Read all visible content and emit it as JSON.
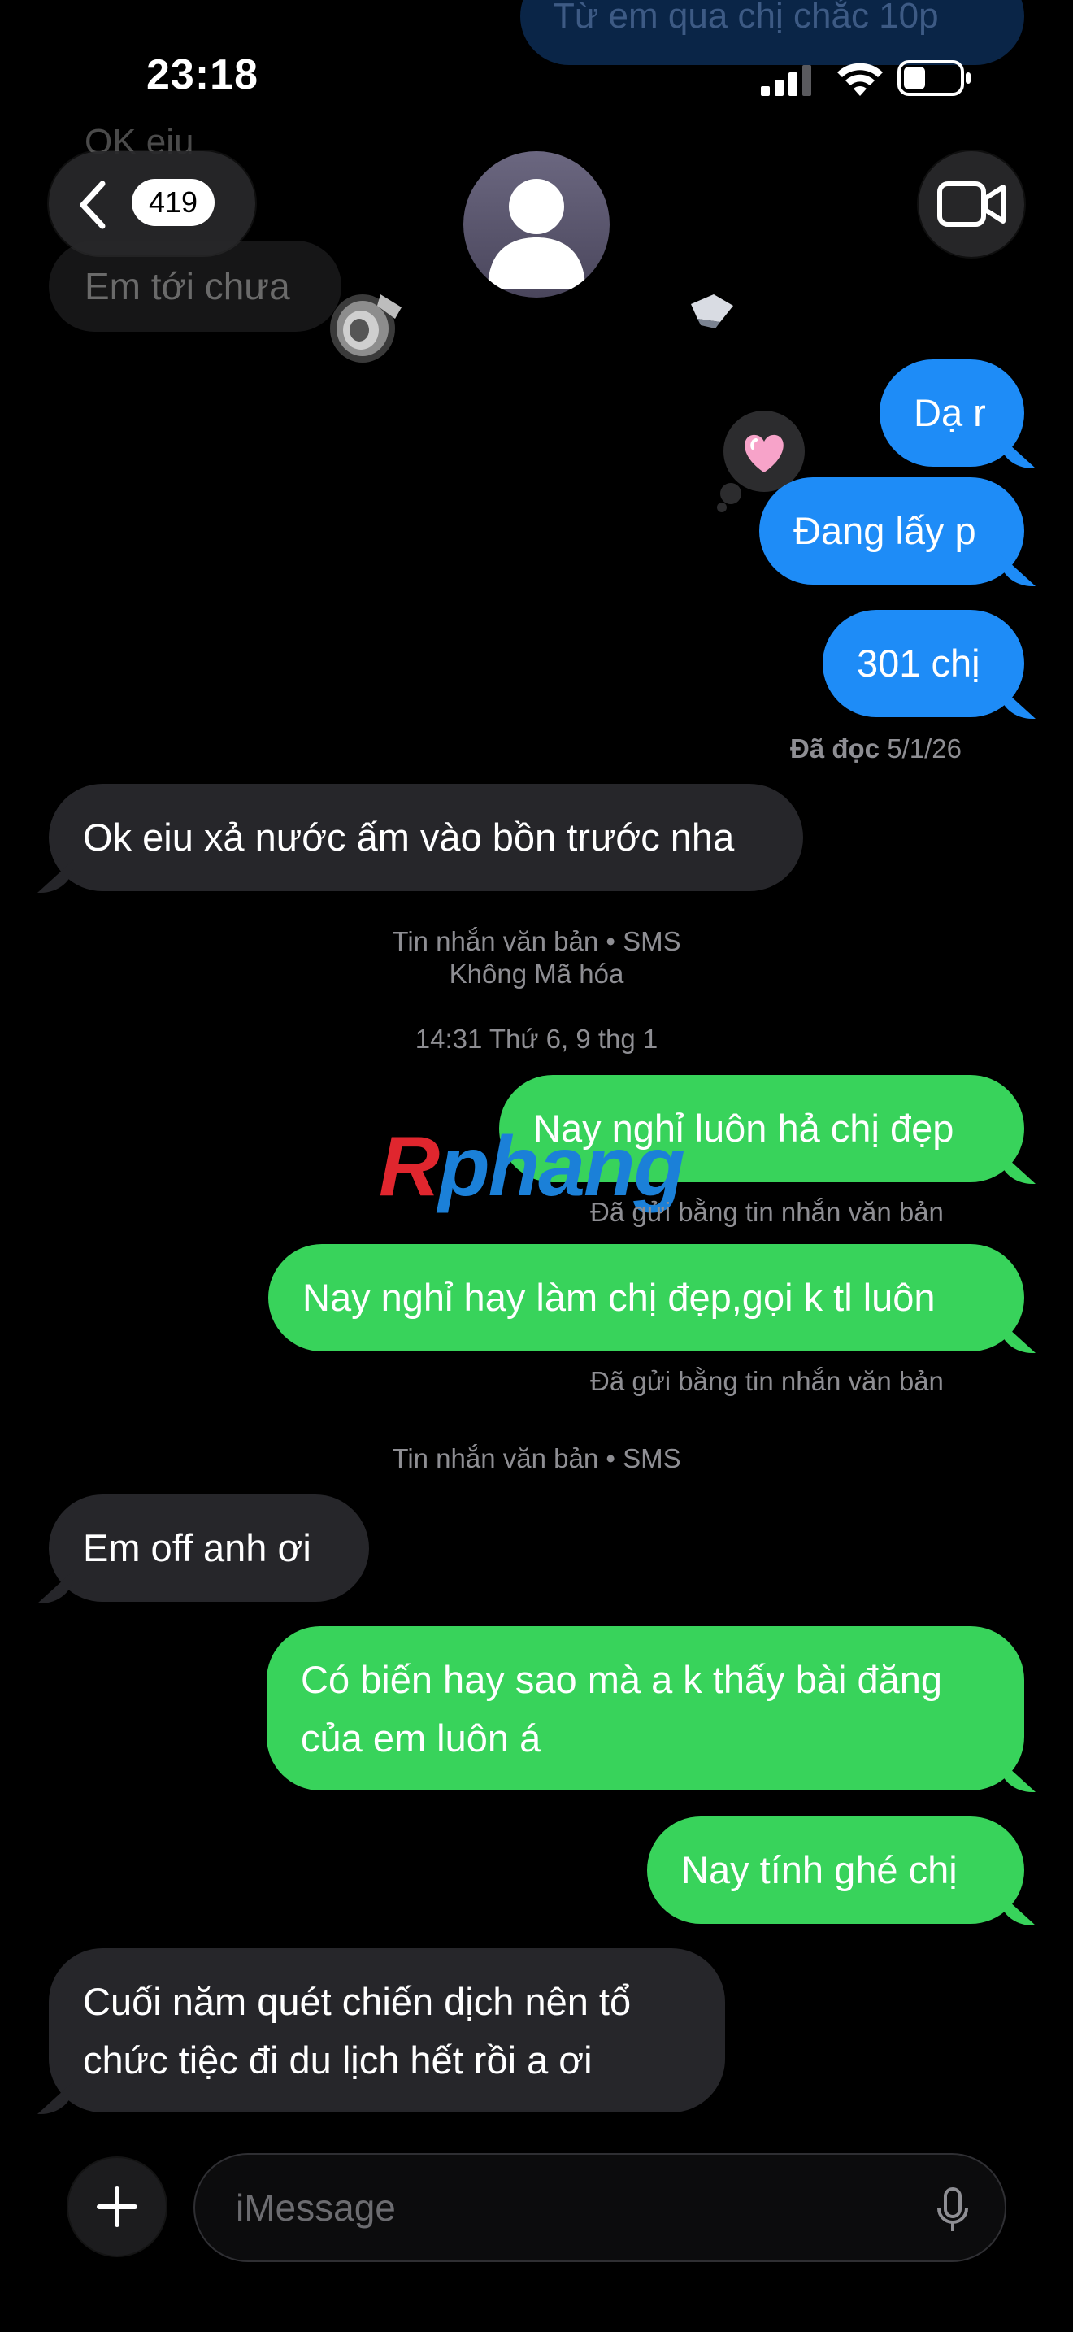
{
  "status_bar": {
    "time": "23:18"
  },
  "header": {
    "unread_count": "419"
  },
  "faded_history": {
    "top_sent_text": "Từ em qua chị chắc 10p",
    "prev_received_text": "OK eiu",
    "received_text": "Em tới chưa"
  },
  "messages": [
    {
      "id": "m1",
      "type": "sent",
      "service": "imessage",
      "text": "Dạ r"
    },
    {
      "id": "m2",
      "type": "sent",
      "service": "imessage",
      "text": "Đang lấy p",
      "reaction": "heart"
    },
    {
      "id": "m3",
      "type": "sent",
      "service": "imessage",
      "text": "301 chị"
    },
    {
      "id": "m4",
      "type": "received",
      "text": "Ok eiu xả nước ấm vào bồn trước nha"
    },
    {
      "id": "m5",
      "type": "sent",
      "service": "sms",
      "text": "Nay nghỉ luôn hả chị đẹp"
    },
    {
      "id": "m6",
      "type": "sent",
      "service": "sms",
      "text": "Nay nghỉ hay làm chị đẹp,gọi k tl luôn"
    },
    {
      "id": "m7",
      "type": "received",
      "text": "Em off anh ơi"
    },
    {
      "id": "m8",
      "type": "sent",
      "service": "sms",
      "text_line1": "Có biến hay sao mà a k thấy bài đăng",
      "text_line2": "của em luôn á"
    },
    {
      "id": "m9",
      "type": "sent",
      "service": "sms",
      "text": "Nay tính ghé chị"
    },
    {
      "id": "m10",
      "type": "received",
      "text_line1": "Cuối năm quét chiến dịch nên tổ",
      "text_line2": "chức tiệc đi du lịch hết rồi a ơi"
    }
  ],
  "labels": {
    "read_label": "Đã đọc",
    "read_date": "5/1/26",
    "sms_label_1": "Tin nhắn văn bản • SMS",
    "not_encrypted": "Không Mã hóa",
    "timestamp": "14:31 Thứ 6, 9 thg 1",
    "sent_as_text": "Đã gửi bằng tin nhắn văn bản",
    "sms_label_2": "Tin nhắn văn bản • SMS"
  },
  "watermark": {
    "first_letter": "R",
    "rest": "phang"
  },
  "input_bar": {
    "placeholder": "iMessage"
  },
  "colors": {
    "imessage_blue": "#1e8cf7",
    "sms_green": "#38d35b",
    "received_gray": "#26262a",
    "background": "#000000"
  },
  "icons": [
    "chevron-left-icon",
    "person-icon",
    "video-camera-icon",
    "plus-icon",
    "microphone-icon",
    "heart-icon",
    "signal-icon",
    "wifi-icon",
    "battery-icon"
  ]
}
